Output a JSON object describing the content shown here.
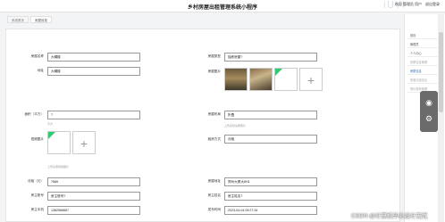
{
  "header": {
    "title": "乡村房屋出租管理系统小程序",
    "user": [
      "欢迎 管理员 用户",
      "退出登录"
    ],
    "watermark": "iUYI"
  },
  "breadcrumb": [
    "系统首页",
    "房屋信息"
  ],
  "form": {
    "house_name_label": "房屋名称",
    "house_name_value": "大碉楼",
    "house_type_label": "房屋类型",
    "house_type_value": "独栋房屋?",
    "address_label": "地址",
    "address_value": "大碉楼",
    "house_image_label": "房屋图片",
    "image_hint": "上传多张房屋照片",
    "area_label": "面积（平方）",
    "area_value": "7",
    "area_unit": "平方",
    "layout_label": "房屋布局",
    "layout_value": "折叠",
    "video_label": "视频图片",
    "video_hint": "上传房源视频图片",
    "rent_method_label": "租房方式",
    "rent_method_value": "月租",
    "rent_label": "月租（元）",
    "rent_value": "7689",
    "location_label": "房屋地址",
    "location_value": "郑州大厦大8H1",
    "landlord_no_label": "房主账号",
    "landlord_no_value": "房主账号7",
    "landlord_name_label": "房主姓名",
    "landlord_name_value": "房主姓名7",
    "phone_label": "房主手机",
    "phone_value": "1382566667",
    "publish_time_label": "发布时间",
    "publish_time_value": "2023-04-04 09:27:34"
  },
  "sidebar": {
    "items": [
      "首页",
      "管理员",
      "个人中心",
      "房屋信息管理",
      "房屋信息",
      "房源出租信息",
      "预约看房管理"
    ]
  },
  "footer": {
    "csdn": "CSDN @计算机毕业设计无忧"
  },
  "colors": {
    "accent": "#2ecc71",
    "sidebar_highlight": "#3a6fb7"
  }
}
